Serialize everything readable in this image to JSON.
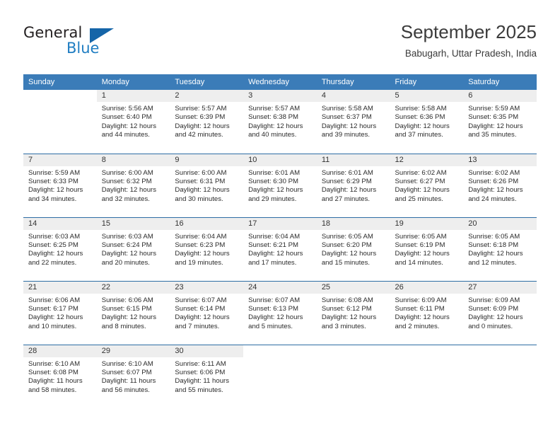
{
  "brand": {
    "name_part1": "General",
    "name_part2": "Blue",
    "triangle_icon": "triangle-logo-icon",
    "accent_color": "#1f7dc2"
  },
  "header": {
    "title": "September 2025",
    "subtitle": "Babugarh, Uttar Pradesh, India"
  },
  "calendar": {
    "header_color": "#3b7cb8",
    "separator_color": "#2e6da4",
    "datenum_bg": "#eeeeee",
    "weekday_headers": [
      "Sunday",
      "Monday",
      "Tuesday",
      "Wednesday",
      "Thursday",
      "Friday",
      "Saturday"
    ],
    "weeks": [
      [
        {
          "date": "",
          "sunrise": "",
          "sunset": "",
          "daylight_line1": "",
          "daylight_line2": ""
        },
        {
          "date": "1",
          "sunrise": "Sunrise: 5:56 AM",
          "sunset": "Sunset: 6:40 PM",
          "daylight_line1": "Daylight: 12 hours",
          "daylight_line2": "and 44 minutes."
        },
        {
          "date": "2",
          "sunrise": "Sunrise: 5:57 AM",
          "sunset": "Sunset: 6:39 PM",
          "daylight_line1": "Daylight: 12 hours",
          "daylight_line2": "and 42 minutes."
        },
        {
          "date": "3",
          "sunrise": "Sunrise: 5:57 AM",
          "sunset": "Sunset: 6:38 PM",
          "daylight_line1": "Daylight: 12 hours",
          "daylight_line2": "and 40 minutes."
        },
        {
          "date": "4",
          "sunrise": "Sunrise: 5:58 AM",
          "sunset": "Sunset: 6:37 PM",
          "daylight_line1": "Daylight: 12 hours",
          "daylight_line2": "and 39 minutes."
        },
        {
          "date": "5",
          "sunrise": "Sunrise: 5:58 AM",
          "sunset": "Sunset: 6:36 PM",
          "daylight_line1": "Daylight: 12 hours",
          "daylight_line2": "and 37 minutes."
        },
        {
          "date": "6",
          "sunrise": "Sunrise: 5:59 AM",
          "sunset": "Sunset: 6:35 PM",
          "daylight_line1": "Daylight: 12 hours",
          "daylight_line2": "and 35 minutes."
        }
      ],
      [
        {
          "date": "7",
          "sunrise": "Sunrise: 5:59 AM",
          "sunset": "Sunset: 6:33 PM",
          "daylight_line1": "Daylight: 12 hours",
          "daylight_line2": "and 34 minutes."
        },
        {
          "date": "8",
          "sunrise": "Sunrise: 6:00 AM",
          "sunset": "Sunset: 6:32 PM",
          "daylight_line1": "Daylight: 12 hours",
          "daylight_line2": "and 32 minutes."
        },
        {
          "date": "9",
          "sunrise": "Sunrise: 6:00 AM",
          "sunset": "Sunset: 6:31 PM",
          "daylight_line1": "Daylight: 12 hours",
          "daylight_line2": "and 30 minutes."
        },
        {
          "date": "10",
          "sunrise": "Sunrise: 6:01 AM",
          "sunset": "Sunset: 6:30 PM",
          "daylight_line1": "Daylight: 12 hours",
          "daylight_line2": "and 29 minutes."
        },
        {
          "date": "11",
          "sunrise": "Sunrise: 6:01 AM",
          "sunset": "Sunset: 6:29 PM",
          "daylight_line1": "Daylight: 12 hours",
          "daylight_line2": "and 27 minutes."
        },
        {
          "date": "12",
          "sunrise": "Sunrise: 6:02 AM",
          "sunset": "Sunset: 6:27 PM",
          "daylight_line1": "Daylight: 12 hours",
          "daylight_line2": "and 25 minutes."
        },
        {
          "date": "13",
          "sunrise": "Sunrise: 6:02 AM",
          "sunset": "Sunset: 6:26 PM",
          "daylight_line1": "Daylight: 12 hours",
          "daylight_line2": "and 24 minutes."
        }
      ],
      [
        {
          "date": "14",
          "sunrise": "Sunrise: 6:03 AM",
          "sunset": "Sunset: 6:25 PM",
          "daylight_line1": "Daylight: 12 hours",
          "daylight_line2": "and 22 minutes."
        },
        {
          "date": "15",
          "sunrise": "Sunrise: 6:03 AM",
          "sunset": "Sunset: 6:24 PM",
          "daylight_line1": "Daylight: 12 hours",
          "daylight_line2": "and 20 minutes."
        },
        {
          "date": "16",
          "sunrise": "Sunrise: 6:04 AM",
          "sunset": "Sunset: 6:23 PM",
          "daylight_line1": "Daylight: 12 hours",
          "daylight_line2": "and 19 minutes."
        },
        {
          "date": "17",
          "sunrise": "Sunrise: 6:04 AM",
          "sunset": "Sunset: 6:21 PM",
          "daylight_line1": "Daylight: 12 hours",
          "daylight_line2": "and 17 minutes."
        },
        {
          "date": "18",
          "sunrise": "Sunrise: 6:05 AM",
          "sunset": "Sunset: 6:20 PM",
          "daylight_line1": "Daylight: 12 hours",
          "daylight_line2": "and 15 minutes."
        },
        {
          "date": "19",
          "sunrise": "Sunrise: 6:05 AM",
          "sunset": "Sunset: 6:19 PM",
          "daylight_line1": "Daylight: 12 hours",
          "daylight_line2": "and 14 minutes."
        },
        {
          "date": "20",
          "sunrise": "Sunrise: 6:05 AM",
          "sunset": "Sunset: 6:18 PM",
          "daylight_line1": "Daylight: 12 hours",
          "daylight_line2": "and 12 minutes."
        }
      ],
      [
        {
          "date": "21",
          "sunrise": "Sunrise: 6:06 AM",
          "sunset": "Sunset: 6:17 PM",
          "daylight_line1": "Daylight: 12 hours",
          "daylight_line2": "and 10 minutes."
        },
        {
          "date": "22",
          "sunrise": "Sunrise: 6:06 AM",
          "sunset": "Sunset: 6:15 PM",
          "daylight_line1": "Daylight: 12 hours",
          "daylight_line2": "and 8 minutes."
        },
        {
          "date": "23",
          "sunrise": "Sunrise: 6:07 AM",
          "sunset": "Sunset: 6:14 PM",
          "daylight_line1": "Daylight: 12 hours",
          "daylight_line2": "and 7 minutes."
        },
        {
          "date": "24",
          "sunrise": "Sunrise: 6:07 AM",
          "sunset": "Sunset: 6:13 PM",
          "daylight_line1": "Daylight: 12 hours",
          "daylight_line2": "and 5 minutes."
        },
        {
          "date": "25",
          "sunrise": "Sunrise: 6:08 AM",
          "sunset": "Sunset: 6:12 PM",
          "daylight_line1": "Daylight: 12 hours",
          "daylight_line2": "and 3 minutes."
        },
        {
          "date": "26",
          "sunrise": "Sunrise: 6:09 AM",
          "sunset": "Sunset: 6:11 PM",
          "daylight_line1": "Daylight: 12 hours",
          "daylight_line2": "and 2 minutes."
        },
        {
          "date": "27",
          "sunrise": "Sunrise: 6:09 AM",
          "sunset": "Sunset: 6:09 PM",
          "daylight_line1": "Daylight: 12 hours",
          "daylight_line2": "and 0 minutes."
        }
      ],
      [
        {
          "date": "28",
          "sunrise": "Sunrise: 6:10 AM",
          "sunset": "Sunset: 6:08 PM",
          "daylight_line1": "Daylight: 11 hours",
          "daylight_line2": "and 58 minutes."
        },
        {
          "date": "29",
          "sunrise": "Sunrise: 6:10 AM",
          "sunset": "Sunset: 6:07 PM",
          "daylight_line1": "Daylight: 11 hours",
          "daylight_line2": "and 56 minutes."
        },
        {
          "date": "30",
          "sunrise": "Sunrise: 6:11 AM",
          "sunset": "Sunset: 6:06 PM",
          "daylight_line1": "Daylight: 11 hours",
          "daylight_line2": "and 55 minutes."
        },
        {
          "date": "",
          "sunrise": "",
          "sunset": "",
          "daylight_line1": "",
          "daylight_line2": ""
        },
        {
          "date": "",
          "sunrise": "",
          "sunset": "",
          "daylight_line1": "",
          "daylight_line2": ""
        },
        {
          "date": "",
          "sunrise": "",
          "sunset": "",
          "daylight_line1": "",
          "daylight_line2": ""
        },
        {
          "date": "",
          "sunrise": "",
          "sunset": "",
          "daylight_line1": "",
          "daylight_line2": ""
        }
      ]
    ]
  }
}
